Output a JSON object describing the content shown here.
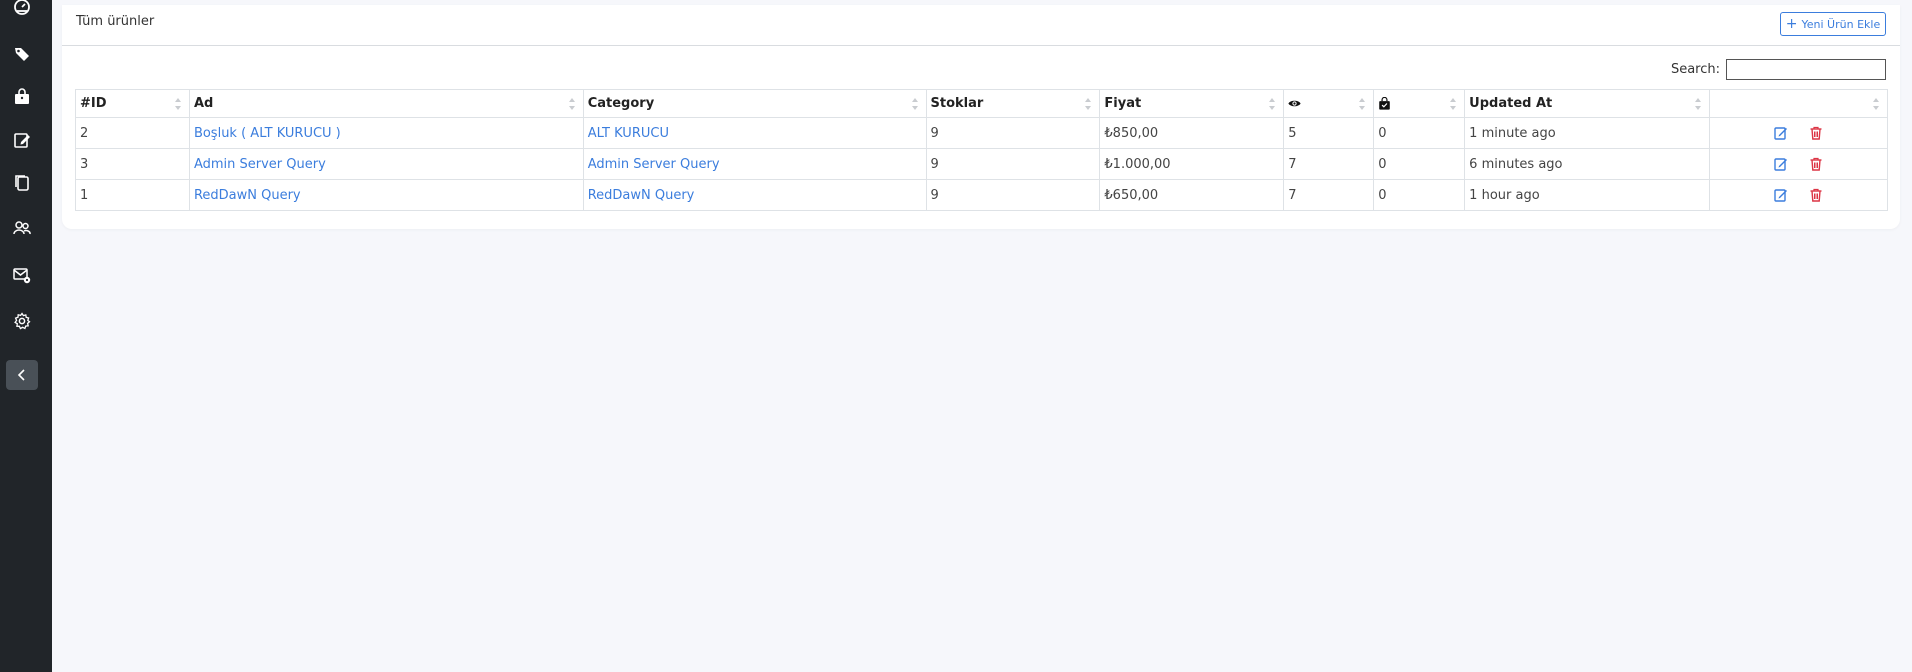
{
  "sidebar": {
    "items": [
      {
        "icon": "dashboard-icon"
      },
      {
        "icon": "tags-icon"
      },
      {
        "icon": "shopping-bag-icon"
      },
      {
        "icon": "edit-icon"
      },
      {
        "icon": "copy-icon"
      },
      {
        "icon": "users-icon"
      },
      {
        "icon": "mail-settings-icon"
      },
      {
        "icon": "gear-icon"
      }
    ],
    "collapse_icon": "chevron-left-icon"
  },
  "card": {
    "title": "Tüm ürünler",
    "add_button_label": "Yeni Ürün Ekle"
  },
  "search": {
    "label": "Search:",
    "value": ""
  },
  "table": {
    "headers": {
      "id": "#ID",
      "name": "Ad",
      "category": "Category",
      "stock": "Stoklar",
      "price": "Fiyat",
      "views_icon": "eye-icon",
      "sales_icon": "bag-check-icon",
      "updated": "Updated At"
    },
    "rows": [
      {
        "id": "2",
        "name": "Boşluk ( ALT KURUCU )",
        "category": "ALT KURUCU",
        "stock": "9",
        "price": "₺850,00",
        "views": "5",
        "sales": "0",
        "updated": "1 minute ago"
      },
      {
        "id": "3",
        "name": "Admin Server Query",
        "category": "Admin Server Query",
        "stock": "9",
        "price": "₺1.000,00",
        "views": "7",
        "sales": "0",
        "updated": "6 minutes ago"
      },
      {
        "id": "1",
        "name": "RedDawN Query",
        "category": "RedDawN Query",
        "stock": "9",
        "price": "₺650,00",
        "views": "7",
        "sales": "0",
        "updated": "1 hour ago"
      }
    ]
  },
  "colors": {
    "sidebar_bg": "#212529",
    "accent": "#3b7ddd",
    "danger": "#dc3545"
  }
}
